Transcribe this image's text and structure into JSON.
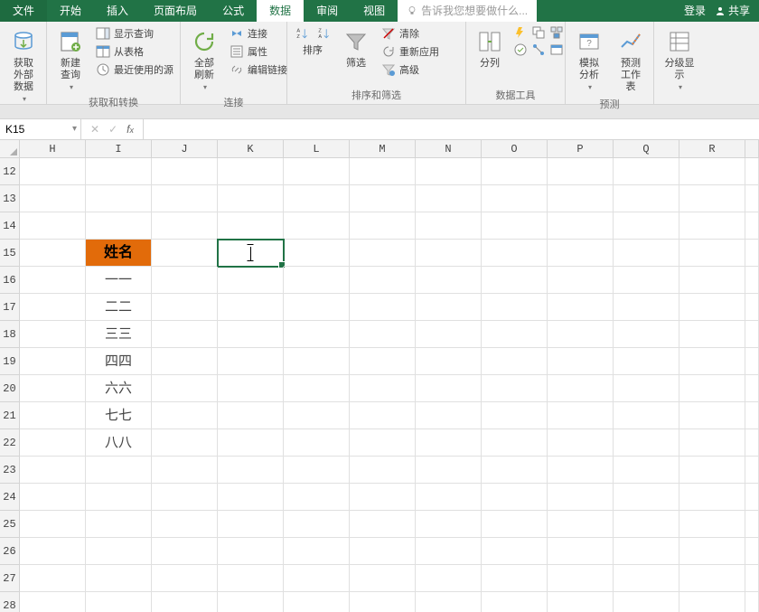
{
  "menu": {
    "tabs": [
      "文件",
      "开始",
      "插入",
      "页面布局",
      "公式",
      "数据",
      "审阅",
      "视图"
    ],
    "active_index": 5,
    "tell_me": "告诉我您想要做什么...",
    "login": "登录",
    "share": "共享"
  },
  "ribbon": {
    "g_external": {
      "get_data": "获取\n外部数据",
      "label": ""
    },
    "g_transform": {
      "new_query": "新建\n查询",
      "show_queries": "显示查询",
      "from_table": "从表格",
      "recent_sources": "最近使用的源",
      "label": "获取和转换"
    },
    "g_conn": {
      "refresh_all": "全部刷新",
      "connections": "连接",
      "properties": "属性",
      "edit_links": "编辑链接",
      "label": "连接"
    },
    "g_sort": {
      "sort": "排序",
      "filter": "筛选",
      "clear": "清除",
      "reapply": "重新应用",
      "advanced": "高级",
      "label": "排序和筛选"
    },
    "g_tools": {
      "text_to_cols": "分列",
      "label": "数据工具"
    },
    "g_forecast": {
      "whatif": "模拟分析",
      "forecast": "预测\n工作表",
      "label": "预测"
    },
    "g_outline": {
      "outline": "分级显示",
      "label": ""
    }
  },
  "formula_bar": {
    "namebox": "K15",
    "formula": ""
  },
  "grid": {
    "columns": [
      "H",
      "I",
      "J",
      "K",
      "L",
      "M",
      "N",
      "O",
      "P",
      "Q",
      "R"
    ],
    "rows": [
      12,
      13,
      14,
      15,
      16,
      17,
      18,
      19,
      20,
      21,
      22,
      23,
      24,
      25,
      26,
      27,
      28
    ],
    "active": {
      "row": 15,
      "col": "K"
    },
    "data": {
      "I15": {
        "value": "姓名",
        "style": "hdrcell"
      },
      "I16": {
        "value": "一一"
      },
      "I17": {
        "value": "二二"
      },
      "I18": {
        "value": "三三"
      },
      "I19": {
        "value": "四四"
      },
      "I20": {
        "value": "六六"
      },
      "I21": {
        "value": "七七"
      },
      "I22": {
        "value": "八八"
      }
    }
  }
}
